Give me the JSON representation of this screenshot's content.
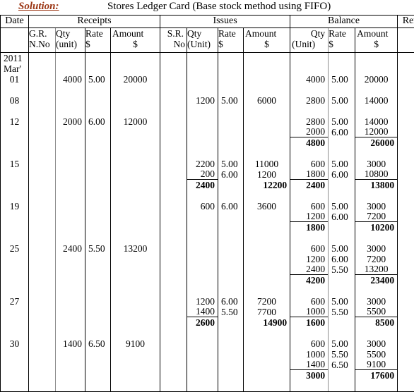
{
  "header": {
    "solution_label": "Solution:",
    "title": "Stores Ledger Card (Base stock method using FIFO)"
  },
  "table": {
    "groups": {
      "date": "Date",
      "receipts": "Receipts",
      "issues": "Issues",
      "balance": "Balance",
      "remarks": "Remarks"
    },
    "subheaders": {
      "gr_no_l1": "G.R.",
      "gr_no_l2": "N.No",
      "r_qty_l1": "Qty",
      "r_qty_l2": "(unit)",
      "r_rate_l1": "Rate",
      "r_rate_l2": "$",
      "r_amt_l1": "Amount",
      "r_amt_l2": "$",
      "sr_no_l1": "S.R.",
      "sr_no_l2": "No",
      "i_qty_l1": "Qty",
      "i_qty_l2": "(Unit)",
      "i_rate_l1": "Rate",
      "i_rate_l2": "$",
      "i_amt_l1": "Amount",
      "i_amt_l2": "$",
      "b_qty_l1": "Qty",
      "b_qty_l2": "(Unit)",
      "b_rate_l1": "Rate",
      "b_rate_l2": "$",
      "b_amt_l1": "Amount",
      "b_amt_l2": "$"
    }
  },
  "ledger": {
    "year": "2011",
    "month": "Mar'",
    "rows": [
      {
        "date": "01",
        "receipts": {
          "qty": [
            "4000"
          ],
          "rate": [
            "5.00"
          ],
          "amount": [
            "20000"
          ]
        },
        "issues": {
          "qty": [],
          "rate": [],
          "amount": []
        },
        "balance": {
          "qty": [
            "4000"
          ],
          "rate": [
            "5.00"
          ],
          "amount": [
            "20000"
          ]
        }
      },
      {
        "date": "08",
        "receipts": {
          "qty": [],
          "rate": [],
          "amount": []
        },
        "issues": {
          "qty": [
            "1200"
          ],
          "rate": [
            "5.00"
          ],
          "amount": [
            "6000"
          ]
        },
        "balance": {
          "qty": [
            "2800"
          ],
          "rate": [
            "5.00"
          ],
          "amount": [
            "14000"
          ]
        }
      },
      {
        "date": "12",
        "receipts": {
          "qty": [
            "2000"
          ],
          "rate": [
            "6.00"
          ],
          "amount": [
            "12000"
          ]
        },
        "issues": {
          "qty": [],
          "rate": [],
          "amount": []
        },
        "balance": {
          "qty": [
            "2800",
            "2000"
          ],
          "rate": [
            "5.00",
            "6.00"
          ],
          "amount": [
            "14000",
            "12000"
          ]
        },
        "balance_total": {
          "qty": "4800",
          "amount": "26000"
        }
      },
      {
        "date": "15",
        "receipts": {
          "qty": [],
          "rate": [],
          "amount": []
        },
        "issues": {
          "qty": [
            "2200",
            "200"
          ],
          "rate": [
            "5.00",
            "6.00"
          ],
          "amount": [
            "11000",
            "1200"
          ]
        },
        "issues_total": {
          "qty": "2400",
          "amount": "12200"
        },
        "balance": {
          "qty": [
            "600",
            "1800"
          ],
          "rate": [
            "5.00",
            "6.00"
          ],
          "amount": [
            "3000",
            "10800"
          ]
        },
        "balance_total": {
          "qty": "2400",
          "amount": "13800"
        }
      },
      {
        "date": "19",
        "receipts": {
          "qty": [],
          "rate": [],
          "amount": []
        },
        "issues": {
          "qty": [
            "600"
          ],
          "rate": [
            "6.00"
          ],
          "amount": [
            "3600"
          ]
        },
        "balance": {
          "qty": [
            "600",
            "1200"
          ],
          "rate": [
            "5.00",
            "6.00"
          ],
          "amount": [
            "3000",
            "7200"
          ]
        },
        "balance_total": {
          "qty": "1800",
          "amount": "10200"
        }
      },
      {
        "date": "25",
        "receipts": {
          "qty": [
            "2400"
          ],
          "rate": [
            "5.50"
          ],
          "amount": [
            "13200"
          ]
        },
        "issues": {
          "qty": [],
          "rate": [],
          "amount": []
        },
        "balance": {
          "qty": [
            "600",
            "1200",
            "2400"
          ],
          "rate": [
            "5.00",
            "6.00",
            "5.50"
          ],
          "amount": [
            "3000",
            "7200",
            "13200"
          ]
        },
        "balance_total": {
          "qty": "4200",
          "amount": "23400"
        }
      },
      {
        "date": "27",
        "receipts": {
          "qty": [],
          "rate": [],
          "amount": []
        },
        "issues": {
          "qty": [
            "1200",
            "1400"
          ],
          "rate": [
            "6.00",
            "5.50"
          ],
          "amount": [
            "7200",
            "7700"
          ]
        },
        "issues_total": {
          "qty": "2600",
          "amount": "14900"
        },
        "balance": {
          "qty": [
            "600",
            "1000"
          ],
          "rate": [
            "5.00",
            "5.50"
          ],
          "amount": [
            "3000",
            "5500"
          ]
        },
        "balance_total": {
          "qty": "1600",
          "amount": "8500"
        }
      },
      {
        "date": "30",
        "receipts": {
          "qty": [
            "1400"
          ],
          "rate": [
            "6.50"
          ],
          "amount": [
            "9100"
          ]
        },
        "issues": {
          "qty": [],
          "rate": [],
          "amount": []
        },
        "balance": {
          "qty": [
            "600",
            "1000",
            "1400"
          ],
          "rate": [
            "5.00",
            "5.50",
            "6.50"
          ],
          "amount": [
            "3000",
            "5500",
            "9100"
          ]
        },
        "balance_total": {
          "qty": "3000",
          "amount": "17600"
        }
      }
    ]
  },
  "colors": {
    "solution_text": "#9a3412",
    "grid_line": "#000000",
    "gray_line": "#8c8c8c",
    "background": "#ffffff"
  }
}
